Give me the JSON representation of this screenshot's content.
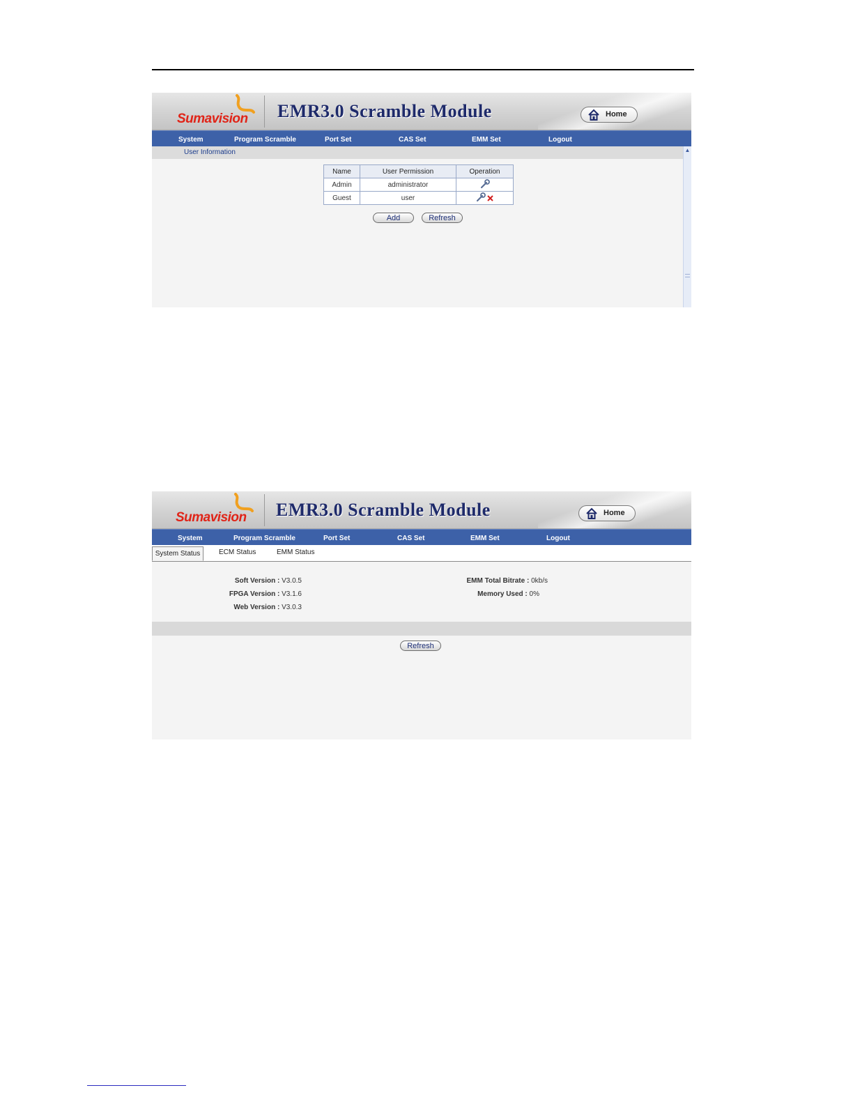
{
  "header": {
    "logo_text": "Sumavision",
    "app_title": "EMR3.0  Scramble  Module",
    "home_label": "Home"
  },
  "nav": [
    "System",
    "Program Scramble",
    "Port Set",
    "CAS Set",
    "EMM Set",
    "Logout"
  ],
  "screen1": {
    "section_title": "User Information",
    "table": {
      "headers": [
        "Name",
        "User Permission",
        "Operation"
      ],
      "rows": [
        {
          "name": "Admin",
          "permission": "administrator",
          "ops": [
            "edit-icon"
          ]
        },
        {
          "name": "Guest",
          "permission": "user",
          "ops": [
            "edit-icon",
            "delete-icon"
          ]
        }
      ]
    },
    "buttons": {
      "add": "Add",
      "refresh": "Refresh"
    }
  },
  "screen2": {
    "tabs": [
      "System Status",
      "ECM Status",
      "EMM Status"
    ],
    "left_status": [
      {
        "label": "Soft Version :",
        "value": "V3.0.5"
      },
      {
        "label": "FPGA Version :",
        "value": "V3.1.6"
      },
      {
        "label": "Web Version :",
        "value": "V3.0.3"
      }
    ],
    "right_status": [
      {
        "label": "EMM Total Bitrate :",
        "value": "0kb/s"
      },
      {
        "label": "Memory Used :",
        "value": "0%"
      }
    ],
    "refresh": "Refresh"
  },
  "colors": {
    "nav_bg": "#3d61a8",
    "title_text": "#1e2a6a",
    "logo_red": "#e02418",
    "logo_flame": "#f0a020"
  }
}
